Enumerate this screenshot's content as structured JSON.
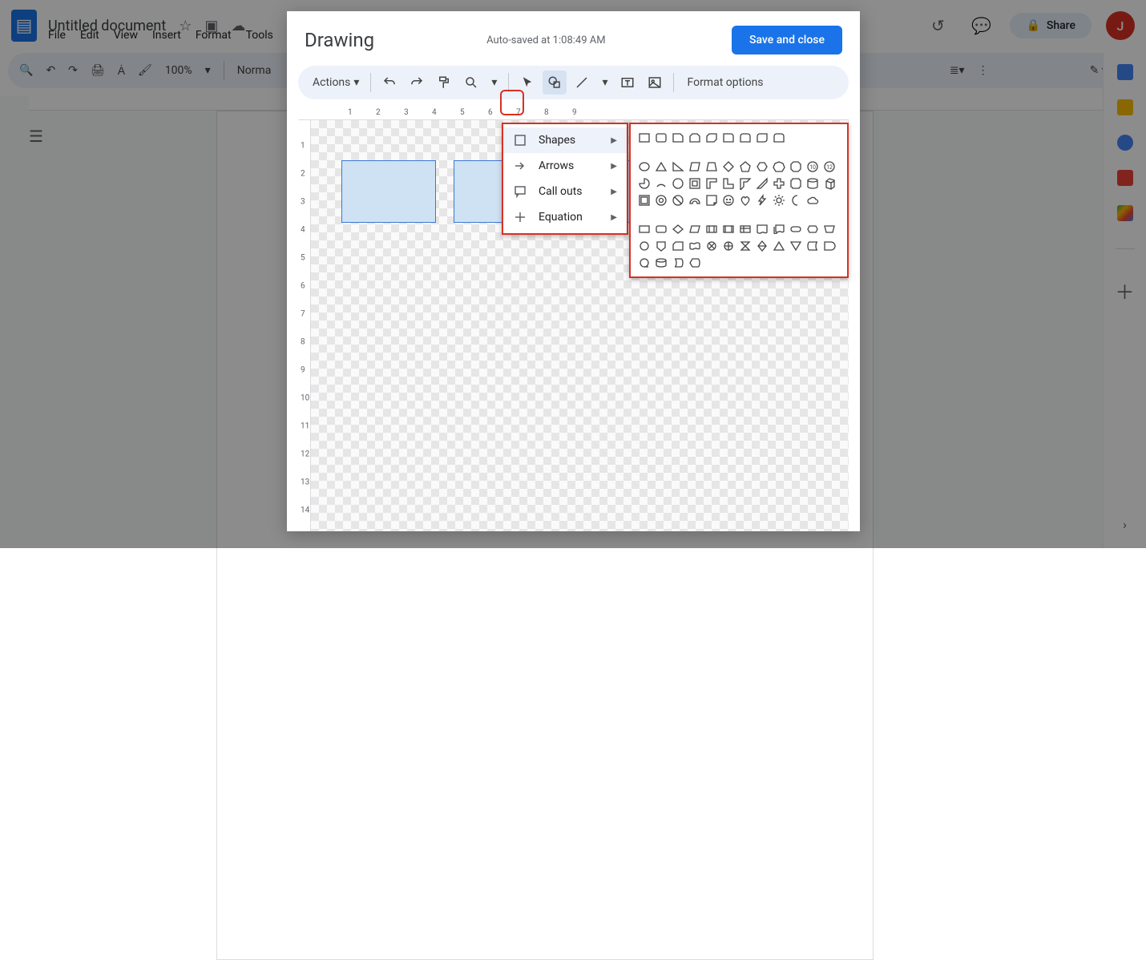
{
  "docs": {
    "title": "Untitled document",
    "menus": [
      "File",
      "Edit",
      "View",
      "Insert",
      "Format",
      "Tools"
    ],
    "share": "Share",
    "zoom": "100%",
    "style": "Norma",
    "avatar": "J"
  },
  "dialog": {
    "title": "Drawing",
    "autosave": "Auto-saved at 1:08:49 AM",
    "save": "Save and close",
    "actions": "Actions",
    "format_options": "Format options",
    "ruler_h": [
      "1",
      "2",
      "3",
      "4",
      "5",
      "6",
      "7",
      "8",
      "9"
    ],
    "ruler_v": [
      "1",
      "2",
      "3",
      "4",
      "5",
      "6",
      "7",
      "8",
      "9",
      "10",
      "11",
      "12",
      "13",
      "14"
    ]
  },
  "dropdown": {
    "shapes": "Shapes",
    "arrows": "Arrows",
    "callouts": "Call outs",
    "equation": "Equation"
  },
  "shapes_group1": [
    "rect",
    "round-rect",
    "snip1",
    "snip2",
    "snip-diag",
    "round1",
    "round2",
    "round-diag",
    "round-same"
  ],
  "shapes_group2": [
    "ellipse",
    "triangle",
    "rt-triangle",
    "parallelogram",
    "trapezoid",
    "diamond",
    "pentagon",
    "hexagon",
    "heptagon",
    "octagon",
    "decagon",
    "dodecagon",
    "pie",
    "arc",
    "teardrop",
    "frame",
    "half-frame",
    "l-shape",
    "corner",
    "diag-stripe",
    "plus",
    "plaque",
    "can",
    "cube",
    "bevel",
    "donut",
    "no-symbol",
    "block-arc",
    "folded-corner",
    "smiley",
    "heart",
    "lightning",
    "sun",
    "moon",
    "cloud"
  ],
  "shapes_group3": [
    "flow-rect",
    "flow-roundrect",
    "flow-diamond",
    "flow-para",
    "flow-data",
    "flow-predef",
    "flow-internal",
    "flow-doc",
    "flow-multidoc",
    "flow-term",
    "flow-prep",
    "flow-manual",
    "flow-connector",
    "flow-offpage",
    "flow-card",
    "flow-tape",
    "flow-sumjunc",
    "flow-or",
    "flow-collate",
    "flow-sort",
    "flow-extract",
    "flow-merge",
    "flow-stored",
    "flow-delay",
    "flow-seqstor",
    "flow-magdisk",
    "flow-directstor",
    "flow-display"
  ]
}
